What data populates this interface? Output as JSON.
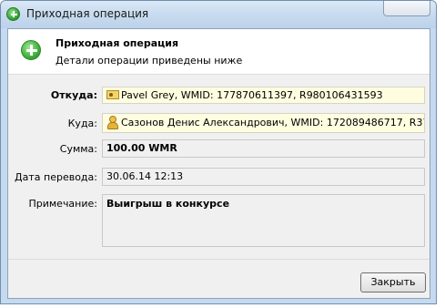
{
  "window": {
    "title": "Приходная операция"
  },
  "header": {
    "title": "Приходная операция",
    "subtitle": "Детали операции приведены ниже"
  },
  "fields": {
    "from": {
      "label": "Откуда:",
      "value": "Pavel Grey, WMID: 177870611397, R980106431593"
    },
    "to": {
      "label": "Куда:",
      "value": "Сазонов Денис Александрович, WMID: 172089486717, R37178..."
    },
    "amount": {
      "label": "Сумма:",
      "value": "100.00 WMR"
    },
    "date": {
      "label": "Дата перевода:",
      "value": "30.06.14 12:13"
    },
    "note": {
      "label": "Примечание:",
      "value": "Выигрыш в конкурсе"
    }
  },
  "footer": {
    "close_label": "Закрыть"
  },
  "icons": {
    "title": "plus-circle-icon",
    "header": "plus-circle-icon",
    "from": "id-card-icon",
    "to": "person-icon"
  },
  "colors": {
    "accent_green": "#3aaa35",
    "highlight_field": "#fffde0"
  }
}
